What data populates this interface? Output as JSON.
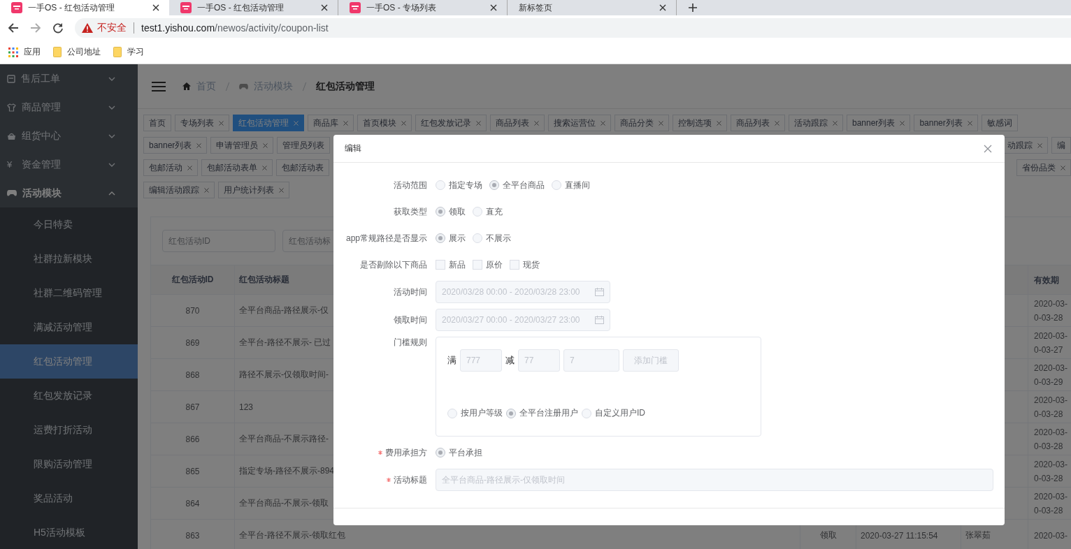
{
  "browser": {
    "tabs": [
      {
        "title": "一手OS - 红包活动管理",
        "kind": "site",
        "selected": true
      },
      {
        "title": "一手OS - 红包活动管理",
        "kind": "site",
        "selected": false
      },
      {
        "title": "一手OS - 专场列表",
        "kind": "site",
        "selected": false
      },
      {
        "title": "新标签页",
        "kind": "blank",
        "selected": false
      }
    ],
    "address": {
      "security": "不安全",
      "host": "test1.yishou.com",
      "path": "/newos/activity/coupon-list"
    },
    "bookmarks": [
      {
        "kind": "apps",
        "label": "应用"
      },
      {
        "kind": "folder",
        "label": "公司地址"
      },
      {
        "kind": "folder",
        "label": "学习"
      }
    ]
  },
  "sidebar": {
    "items": [
      {
        "label": "售后工单",
        "expanded": false
      },
      {
        "label": "商品管理",
        "expanded": false
      },
      {
        "label": "组货中心",
        "expanded": false
      },
      {
        "label": "资金管理",
        "glyph": "¥",
        "expanded": false
      },
      {
        "label": "活动模块",
        "expanded": true,
        "children": [
          {
            "label": "今日特卖",
            "selected": false
          },
          {
            "label": "社群拉新模块",
            "selected": false
          },
          {
            "label": "社群二维码管理",
            "selected": false
          },
          {
            "label": "满减活动管理",
            "selected": false
          },
          {
            "label": "红包活动管理",
            "selected": true
          },
          {
            "label": "红包发放记录",
            "selected": false
          },
          {
            "label": "运费打折活动",
            "selected": false
          },
          {
            "label": "限购活动管理",
            "selected": false
          },
          {
            "label": "奖品活动",
            "selected": false
          },
          {
            "label": "H5活动模板",
            "selected": false
          }
        ]
      }
    ]
  },
  "breadcrumb": [
    {
      "label": "首页",
      "current": false
    },
    {
      "label": "活动模块",
      "current": false
    },
    {
      "label": "红包活动管理",
      "current": true
    }
  ],
  "tag_rows": [
    {
      "left": [
        {
          "label": "首页",
          "selected": false,
          "closable": false
        },
        {
          "label": "专场列表",
          "selected": false,
          "closable": true
        },
        {
          "label": "红包活动管理",
          "selected": true,
          "closable": true
        },
        {
          "label": "商品库",
          "selected": false,
          "closable": true
        },
        {
          "label": "首页模块",
          "selected": false,
          "closable": true
        },
        {
          "label": "红包发放记录",
          "selected": false,
          "closable": true
        },
        {
          "label": "商品列表",
          "selected": false,
          "closable": true
        },
        {
          "label": "搜索运营位",
          "selected": false,
          "closable": true
        },
        {
          "label": "商品分类",
          "selected": false,
          "closable": true
        },
        {
          "label": "控制选项",
          "selected": false,
          "closable": true
        },
        {
          "label": "商品列表",
          "selected": false,
          "closable": true
        },
        {
          "label": "活动跟踪",
          "selected": false,
          "closable": true
        },
        {
          "label": "banner列表",
          "selected": false,
          "closable": true
        },
        {
          "label": "banner列表",
          "selected": false,
          "closable": true
        },
        {
          "label": "敏感词",
          "selected": false,
          "closable": false
        }
      ]
    },
    {
      "left": [
        {
          "label": "banner列表",
          "selected": false,
          "closable": true
        },
        {
          "label": "申请管理员",
          "selected": false,
          "closable": true
        },
        {
          "label": "管理员列表",
          "selected": false,
          "closable": false
        }
      ],
      "right": [
        {
          "label": "动跟踪",
          "selected": false,
          "closable": true
        },
        {
          "label": "编",
          "selected": false,
          "closable": false
        }
      ]
    },
    {
      "left": [
        {
          "label": "包邮活动",
          "selected": false,
          "closable": true
        },
        {
          "label": "包邮活动表单",
          "selected": false,
          "closable": true
        },
        {
          "label": "包邮活动表",
          "selected": false,
          "closable": false
        }
      ],
      "right": [
        {
          "label": "省份品类",
          "selected": false,
          "closable": true
        }
      ]
    },
    {
      "left": [
        {
          "label": "编辑活动跟踪",
          "selected": false,
          "closable": true
        },
        {
          "label": "用户统计列表",
          "selected": false,
          "closable": true
        }
      ]
    }
  ],
  "search": {
    "fields": [
      {
        "placeholder": "红包活动ID"
      },
      {
        "placeholder": "红包活动标"
      }
    ]
  },
  "table": {
    "header": {
      "id": "红包活动ID",
      "title": "红包活动标题",
      "validity": "有效期"
    },
    "rows": [
      {
        "id": "870",
        "title": "全平台商品-路径展示-仅",
        "validity": "2020-03-\n0-03-28"
      },
      {
        "id": "869",
        "title": "全平台-路径不展示- 已过",
        "validity": "2020-03-\n0-03-27"
      },
      {
        "id": "868",
        "title": "路径不展示-仅领取时间-",
        "validity": "2020-03-\n0-03-29"
      },
      {
        "id": "867",
        "title": "123",
        "validity": "2020-03-\n0-03-28"
      },
      {
        "id": "866",
        "title": "全平台商品-不展示路径-",
        "validity": "2020-03-\n0-03-28"
      },
      {
        "id": "865",
        "title": "指定专场-路径不展示-894",
        "validity": "2020-03-\n0-03-28"
      },
      {
        "id": "864",
        "title": "全平台商品-不展示-领取",
        "validity": "2020-03-\n0-03-28"
      },
      {
        "id": "863",
        "title": "全平台-路径不展示-领取红包",
        "type": "领取",
        "created": "2020-03-27 11:15:54",
        "creator": "张翠茹",
        "validity": "2020-03-"
      }
    ]
  },
  "dialog": {
    "title": "编辑",
    "fields": [
      {
        "kind": "radio",
        "label": "活动范围",
        "required": false,
        "options": [
          {
            "label": "指定专场",
            "selected": false
          },
          {
            "label": "全平台商品",
            "selected": true
          },
          {
            "label": "直播间",
            "selected": false
          }
        ]
      },
      {
        "kind": "radio",
        "label": "获取类型",
        "required": false,
        "options": [
          {
            "label": "领取",
            "selected": true
          },
          {
            "label": "直充",
            "selected": false
          }
        ]
      },
      {
        "kind": "radio",
        "label": "app常规路径是否显示",
        "required": false,
        "options": [
          {
            "label": "展示",
            "selected": true
          },
          {
            "label": "不展示",
            "selected": false
          }
        ]
      },
      {
        "kind": "checkbox",
        "label": "是否剔除以下商品",
        "required": false,
        "options": [
          {
            "label": "新品",
            "checked": false
          },
          {
            "label": "原价",
            "checked": false
          },
          {
            "label": "现货",
            "checked": false
          }
        ]
      },
      {
        "kind": "date",
        "label": "活动时间",
        "required": false,
        "value": "2020/03/28 00:00 - 2020/03/28 23:00"
      },
      {
        "kind": "date",
        "label": "领取时间",
        "required": false,
        "value": "2020/03/27 00:00 - 2020/03/27 23:00"
      },
      {
        "kind": "threshold",
        "label": "门槛规则",
        "required": false,
        "full_label": "满",
        "full_value": "777",
        "minus_label": "减",
        "minus_value": "77",
        "third_value": "7",
        "add_button": "添加门槛",
        "user_options": [
          {
            "label": "按用户等级",
            "selected": false
          },
          {
            "label": "全平台注册用户",
            "selected": true
          },
          {
            "label": "自定义用户ID",
            "selected": false
          }
        ]
      },
      {
        "kind": "radio",
        "label": "费用承担方",
        "required": true,
        "options": [
          {
            "label": "平台承担",
            "selected": true
          }
        ]
      },
      {
        "kind": "text",
        "label": "活动标题",
        "required": true,
        "value": "全平台商品-路径展示-仅领取时间"
      }
    ]
  }
}
